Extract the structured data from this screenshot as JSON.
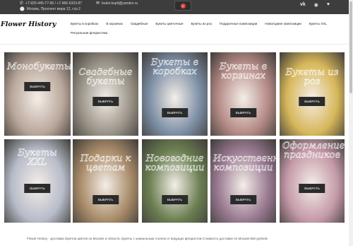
{
  "topbar": {
    "phone": "+7-925-445-77-66 / +7-966-5333-87",
    "address": "Москва, Проспект мира 12, стр.2",
    "email": "buket.kupit@yandex.ru",
    "cart_count": "0",
    "icons": [
      "phone-icon",
      "location-icon",
      "mail-icon",
      "cart-icon",
      "vk-icon",
      "whatsapp-icon",
      "heart-icon"
    ]
  },
  "header": {
    "logo": "Flower History"
  },
  "nav": {
    "row1": [
      "Букеты в коробках",
      "В корзинах",
      "Свадебные",
      "Букеты цветочные",
      "Букеты из роз",
      "Подарочные композиции",
      "Новогодние композиции",
      "Букеты XXL"
    ],
    "row2": [
      "Ритуальная флористика"
    ]
  },
  "tiles": [
    {
      "title": "Монобукеты",
      "button": "ВЫБРАТЬ",
      "color": "#b9a79b"
    },
    {
      "title": "Свадебные букеты",
      "button": "ВЫБРАТЬ",
      "color": "#9a9388"
    },
    {
      "title": "Букеты в коробках",
      "button": "ВЫБРАТЬ",
      "color": "#7d8fa6"
    },
    {
      "title": "Букеты в корзинах",
      "button": "ВЫБРАТЬ",
      "color": "#b48a86"
    },
    {
      "title": "Букеты из роз",
      "button": "ВЫБРАТЬ",
      "color": "#d7b75a"
    },
    {
      "title": "Букеты XXL",
      "button": "ВЫБРАТЬ",
      "color": "#b7bcc9"
    },
    {
      "title": "Подарки к цветам",
      "button": "ВЫБРАТЬ",
      "color": "#a98c6a"
    },
    {
      "title": "Новогодние композиции",
      "button": "ВЫБРАТЬ",
      "color": "#6b7f52"
    },
    {
      "title": "Искусственные композиции",
      "button": "ВЫБРАТЬ",
      "color": "#9a7a92"
    },
    {
      "title": "Оформление праздников",
      "button": "ВЫБРАТЬ",
      "color": "#c59aa9"
    }
  ],
  "footer": {
    "text": "Flower History - доставка букетов цветов по Москве и области. Букеты с уникальным стилем от ведущих флористов.Стоимость доставки по Москве 650 рублей."
  }
}
